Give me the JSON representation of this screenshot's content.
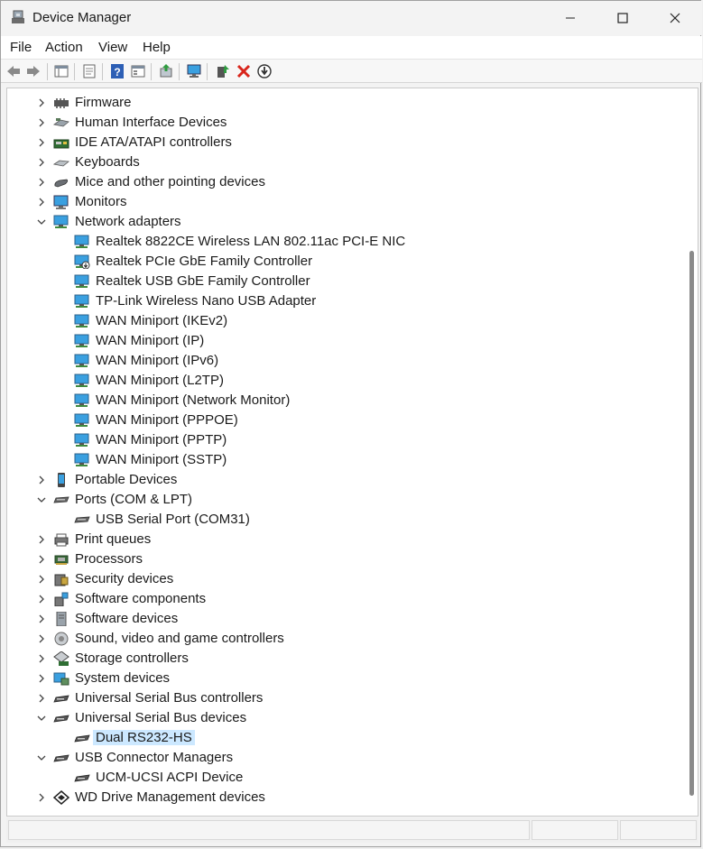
{
  "window": {
    "title": "Device Manager"
  },
  "menu": {
    "file": "File",
    "action": "Action",
    "view": "View",
    "help": "Help"
  },
  "toolbar": {
    "icons": [
      "back-arrow-icon",
      "forward-arrow-icon",
      "properties-pane-icon",
      "device-properties-icon",
      "help-icon",
      "console-tree-icon",
      "update-driver-icon",
      "scan-hardware-icon",
      "enable-device-icon",
      "uninstall-device-icon",
      "download-driver-icon"
    ]
  },
  "tree": {
    "items": [
      {
        "label": "Firmware",
        "level": 0,
        "state": "collapsed",
        "icon": "firmware-chip-icon"
      },
      {
        "label": "Human Interface Devices",
        "level": 0,
        "state": "collapsed",
        "icon": "hid-keyboard-icon"
      },
      {
        "label": "IDE ATA/ATAPI controllers",
        "level": 0,
        "state": "collapsed",
        "icon": "ide-controller-icon"
      },
      {
        "label": "Keyboards",
        "level": 0,
        "state": "collapsed",
        "icon": "keyboard-icon"
      },
      {
        "label": "Mice and other pointing devices",
        "level": 0,
        "state": "collapsed",
        "icon": "mouse-icon"
      },
      {
        "label": "Monitors",
        "level": 0,
        "state": "collapsed",
        "icon": "monitor-icon"
      },
      {
        "label": "Network adapters",
        "level": 0,
        "state": "expanded",
        "icon": "network-adapter-icon"
      },
      {
        "label": "Realtek 8822CE Wireless LAN 802.11ac PCI-E NIC",
        "level": 1,
        "icon": "network-adapter-icon"
      },
      {
        "label": "Realtek PCIe GbE Family Controller",
        "level": 1,
        "icon": "network-adapter-disabled-icon"
      },
      {
        "label": "Realtek USB GbE Family Controller",
        "level": 1,
        "icon": "network-adapter-icon"
      },
      {
        "label": "TP-Link Wireless Nano USB Adapter",
        "level": 1,
        "icon": "network-adapter-icon"
      },
      {
        "label": "WAN Miniport (IKEv2)",
        "level": 1,
        "icon": "network-adapter-icon"
      },
      {
        "label": "WAN Miniport (IP)",
        "level": 1,
        "icon": "network-adapter-icon"
      },
      {
        "label": "WAN Miniport (IPv6)",
        "level": 1,
        "icon": "network-adapter-icon"
      },
      {
        "label": "WAN Miniport (L2TP)",
        "level": 1,
        "icon": "network-adapter-icon"
      },
      {
        "label": "WAN Miniport (Network Monitor)",
        "level": 1,
        "icon": "network-adapter-icon"
      },
      {
        "label": "WAN Miniport (PPPOE)",
        "level": 1,
        "icon": "network-adapter-icon"
      },
      {
        "label": "WAN Miniport (PPTP)",
        "level": 1,
        "icon": "network-adapter-icon"
      },
      {
        "label": "WAN Miniport (SSTP)",
        "level": 1,
        "icon": "network-adapter-icon"
      },
      {
        "label": "Portable Devices",
        "level": 0,
        "state": "collapsed",
        "icon": "portable-device-icon"
      },
      {
        "label": "Ports (COM & LPT)",
        "level": 0,
        "state": "expanded",
        "icon": "port-connector-icon"
      },
      {
        "label": "USB Serial Port (COM31)",
        "level": 1,
        "icon": "port-connector-icon"
      },
      {
        "label": "Print queues",
        "level": 0,
        "state": "collapsed",
        "icon": "printer-icon"
      },
      {
        "label": "Processors",
        "level": 0,
        "state": "collapsed",
        "icon": "processor-icon"
      },
      {
        "label": "Security devices",
        "level": 0,
        "state": "collapsed",
        "icon": "security-device-icon"
      },
      {
        "label": "Software components",
        "level": 0,
        "state": "collapsed",
        "icon": "software-component-icon"
      },
      {
        "label": "Software devices",
        "level": 0,
        "state": "collapsed",
        "icon": "software-device-icon"
      },
      {
        "label": "Sound, video and game controllers",
        "level": 0,
        "state": "collapsed",
        "icon": "speaker-icon"
      },
      {
        "label": "Storage controllers",
        "level": 0,
        "state": "collapsed",
        "icon": "storage-controller-icon"
      },
      {
        "label": "System devices",
        "level": 0,
        "state": "collapsed",
        "icon": "system-device-icon"
      },
      {
        "label": "Universal Serial Bus controllers",
        "level": 0,
        "state": "collapsed",
        "icon": "usb-connector-icon"
      },
      {
        "label": "Universal Serial Bus devices",
        "level": 0,
        "state": "expanded",
        "icon": "usb-connector-icon"
      },
      {
        "label": "Dual RS232-HS",
        "level": 1,
        "icon": "usb-connector-icon",
        "selected": true
      },
      {
        "label": "USB Connector Managers",
        "level": 0,
        "state": "expanded",
        "icon": "usb-connector-icon"
      },
      {
        "label": "UCM-UCSI ACPI Device",
        "level": 1,
        "icon": "usb-connector-icon"
      },
      {
        "label": "WD Drive Management devices",
        "level": 0,
        "state": "collapsed",
        "icon": "wd-drive-icon"
      }
    ]
  },
  "colors": {
    "selection": "#cce8ff",
    "network_blue": "#3aa0e0",
    "uninstall_red": "#d9261c",
    "update_green": "#2e9b3f"
  }
}
